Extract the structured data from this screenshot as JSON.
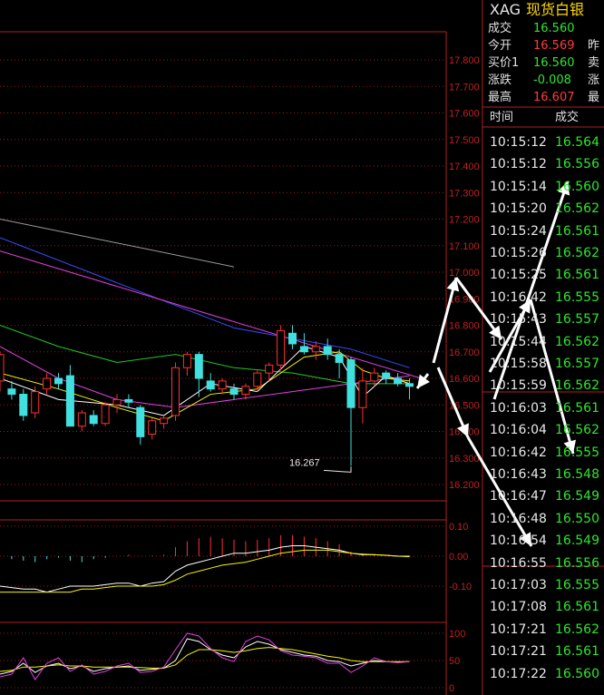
{
  "header": {
    "symbol": "XAG",
    "name": "现货白银"
  },
  "quote": [
    {
      "label": "成交",
      "value": "16.560",
      "color": "#2ee62e",
      "extra": ""
    },
    {
      "label": "今开",
      "value": "16.569",
      "color": "#ff3b3b",
      "extra": "昨"
    },
    {
      "label": "买价1",
      "value": "16.560",
      "color": "#2ee62e",
      "extra": "卖"
    },
    {
      "label": "涨跌",
      "value": "-0.008",
      "color": "#2ee62e",
      "extra": "涨"
    },
    {
      "label": "最高",
      "value": "16.607",
      "color": "#ff3b3b",
      "extra": "最"
    }
  ],
  "ticks_header": {
    "time": "时间",
    "price": "成交"
  },
  "ticks": [
    {
      "time": "10:15:12",
      "price": "16.564"
    },
    {
      "time": "10:15:12",
      "price": "16.556"
    },
    {
      "time": "10:15:14",
      "price": "16.560"
    },
    {
      "time": "10:15:20",
      "price": "16.562"
    },
    {
      "time": "10:15:24",
      "price": "16.561"
    },
    {
      "time": "10:15:26",
      "price": "16.562"
    },
    {
      "time": "10:15:25",
      "price": "16.561"
    },
    {
      "time": "10:16:42",
      "price": "16.555"
    },
    {
      "time": "10:15:43",
      "price": "16.557"
    },
    {
      "time": "10:15:44",
      "price": "16.562"
    },
    {
      "time": "10:15:58",
      "price": "16.557"
    },
    {
      "time": "10:15:59",
      "price": "16.562"
    },
    {
      "time": "10:16:03",
      "price": "16.561"
    },
    {
      "time": "10:16:04",
      "price": "16.562"
    },
    {
      "time": "10:16:42",
      "price": "16.555"
    },
    {
      "time": "10:16:43",
      "price": "16.548"
    },
    {
      "time": "10:16:47",
      "price": "16.549"
    },
    {
      "time": "10:16:48",
      "price": "16.550"
    },
    {
      "time": "10:16:54",
      "price": "16.549"
    },
    {
      "time": "10:16:55",
      "price": "16.556"
    },
    {
      "time": "10:17:03",
      "price": "16.555"
    },
    {
      "time": "10:17:08",
      "price": "16.561"
    },
    {
      "time": "10:17:21",
      "price": "16.562"
    },
    {
      "time": "10:17:21",
      "price": "16.561"
    },
    {
      "time": "10:17:22",
      "price": "16.560"
    }
  ],
  "chart_data": [
    {
      "type": "candlestick",
      "ylim": [
        16.15,
        17.9
      ],
      "yticks": [
        "17.800",
        "17.700",
        "17.600",
        "17.500",
        "17.400",
        "17.300",
        "17.200",
        "17.100",
        "17.000",
        "16.900",
        "16.800",
        "16.700",
        "16.600",
        "16.500",
        "16.400",
        "16.300",
        "16.200"
      ],
      "annotation": "16.267",
      "candles": [
        {
          "o": 16.59,
          "h": 16.7,
          "l": 16.55,
          "c": 16.69
        },
        {
          "o": 16.56,
          "h": 16.59,
          "l": 16.52,
          "c": 16.54
        },
        {
          "o": 16.54,
          "h": 16.56,
          "l": 16.44,
          "c": 16.46
        },
        {
          "o": 16.47,
          "h": 16.57,
          "l": 16.45,
          "c": 16.55
        },
        {
          "o": 16.56,
          "h": 16.62,
          "l": 16.54,
          "c": 16.6
        },
        {
          "o": 16.6,
          "h": 16.62,
          "l": 16.56,
          "c": 16.58
        },
        {
          "o": 16.61,
          "h": 16.65,
          "l": 16.42,
          "c": 16.42
        },
        {
          "o": 16.42,
          "h": 16.48,
          "l": 16.4,
          "c": 16.47
        },
        {
          "o": 16.46,
          "h": 16.48,
          "l": 16.42,
          "c": 16.43
        },
        {
          "o": 16.43,
          "h": 16.51,
          "l": 16.42,
          "c": 16.5
        },
        {
          "o": 16.5,
          "h": 16.54,
          "l": 16.47,
          "c": 16.52
        },
        {
          "o": 16.52,
          "h": 16.54,
          "l": 16.49,
          "c": 16.51
        },
        {
          "o": 16.49,
          "h": 16.5,
          "l": 16.35,
          "c": 16.38
        },
        {
          "o": 16.39,
          "h": 16.45,
          "l": 16.37,
          "c": 16.44
        },
        {
          "o": 16.43,
          "h": 16.46,
          "l": 16.41,
          "c": 16.45
        },
        {
          "o": 16.46,
          "h": 16.66,
          "l": 16.44,
          "c": 16.64
        },
        {
          "o": 16.64,
          "h": 16.7,
          "l": 16.61,
          "c": 16.69
        },
        {
          "o": 16.69,
          "h": 16.7,
          "l": 16.53,
          "c": 16.6
        },
        {
          "o": 16.59,
          "h": 16.62,
          "l": 16.55,
          "c": 16.56
        },
        {
          "o": 16.56,
          "h": 16.6,
          "l": 16.54,
          "c": 16.59
        },
        {
          "o": 16.56,
          "h": 16.58,
          "l": 16.52,
          "c": 16.54
        },
        {
          "o": 16.54,
          "h": 16.58,
          "l": 16.52,
          "c": 16.57
        },
        {
          "o": 16.57,
          "h": 16.63,
          "l": 16.55,
          "c": 16.62
        },
        {
          "o": 16.62,
          "h": 16.66,
          "l": 16.59,
          "c": 16.65
        },
        {
          "o": 16.65,
          "h": 16.8,
          "l": 16.63,
          "c": 16.78
        },
        {
          "o": 16.77,
          "h": 16.8,
          "l": 16.71,
          "c": 16.73
        },
        {
          "o": 16.72,
          "h": 16.77,
          "l": 16.69,
          "c": 16.7
        },
        {
          "o": 16.7,
          "h": 16.74,
          "l": 16.67,
          "c": 16.72
        },
        {
          "o": 16.72,
          "h": 16.75,
          "l": 16.67,
          "c": 16.69
        },
        {
          "o": 16.69,
          "h": 16.71,
          "l": 16.6,
          "c": 16.66
        },
        {
          "o": 16.67,
          "h": 16.68,
          "l": 16.27,
          "c": 16.49
        },
        {
          "o": 16.49,
          "h": 16.64,
          "l": 16.43,
          "c": 16.59
        },
        {
          "o": 16.59,
          "h": 16.64,
          "l": 16.57,
          "c": 16.62
        },
        {
          "o": 16.62,
          "h": 16.63,
          "l": 16.58,
          "c": 16.6
        },
        {
          "o": 16.6,
          "h": 16.62,
          "l": 16.57,
          "c": 16.58
        },
        {
          "o": 16.58,
          "h": 16.6,
          "l": 16.52,
          "c": 16.57
        }
      ],
      "lines": [
        {
          "name": "grey",
          "color": "#9a9a9a",
          "points": [
            [
              0,
              17.2
            ],
            [
              20,
              17.02
            ]
          ]
        },
        {
          "name": "blue",
          "color": "#3b4cff",
          "points": [
            [
              0,
              17.13
            ],
            [
              10,
              16.96
            ],
            [
              20,
              16.79
            ],
            [
              30,
              16.71
            ],
            [
              35,
              16.64
            ]
          ]
        },
        {
          "name": "magenta-trend",
          "color": "#e040e0",
          "points": [
            [
              0,
              17.08
            ],
            [
              36,
              16.6
            ]
          ]
        },
        {
          "name": "green",
          "color": "#22c622",
          "points": [
            [
              0,
              16.8
            ],
            [
              5,
              16.72
            ],
            [
              10,
              16.66
            ],
            [
              15,
              16.69
            ],
            [
              20,
              16.64
            ],
            [
              25,
              16.62
            ],
            [
              30,
              16.58
            ],
            [
              35,
              16.58
            ]
          ]
        },
        {
          "name": "magenta",
          "color": "#e040e0",
          "points": [
            [
              0,
              16.72
            ],
            [
              5,
              16.6
            ],
            [
              10,
              16.52
            ],
            [
              15,
              16.49
            ],
            [
              20,
              16.52
            ],
            [
              25,
              16.55
            ],
            [
              30,
              16.58
            ],
            [
              35,
              16.61
            ]
          ]
        },
        {
          "name": "yellow",
          "color": "#f5f500",
          "points": [
            [
              0,
              16.62
            ],
            [
              5,
              16.56
            ],
            [
              10,
              16.49
            ],
            [
              14,
              16.44
            ],
            [
              18,
              16.54
            ],
            [
              22,
              16.56
            ],
            [
              26,
              16.68
            ],
            [
              29,
              16.7
            ],
            [
              31,
              16.63
            ],
            [
              33,
              16.6
            ],
            [
              35,
              16.59
            ]
          ]
        },
        {
          "name": "white",
          "color": "#ffffff",
          "points": [
            [
              0,
              16.6
            ],
            [
              5,
              16.52
            ],
            [
              10,
              16.5
            ],
            [
              14,
              16.46
            ],
            [
              18,
              16.58
            ],
            [
              22,
              16.55
            ],
            [
              26,
              16.72
            ],
            [
              29,
              16.68
            ],
            [
              31,
              16.53
            ],
            [
              33,
              16.61
            ],
            [
              35,
              16.58
            ]
          ]
        }
      ]
    },
    {
      "type": "macd",
      "ylim": [
        -0.16,
        0.12
      ],
      "yticks": [
        "0.10",
        "0.00",
        "-0.10"
      ],
      "bars": [
        0.0,
        -0.01,
        -0.015,
        -0.02,
        -0.01,
        -0.005,
        -0.015,
        -0.02,
        -0.01,
        -0.005,
        0,
        0.005,
        0,
        0.002,
        0.005,
        0.03,
        0.05,
        0.06,
        0.065,
        0.06,
        0.055,
        0.05,
        0.055,
        0.06,
        0.07,
        0.07,
        0.065,
        0.06,
        0.05,
        0.04,
        0.015,
        0.01,
        0.008,
        0.005,
        0.003,
        0.002
      ],
      "dif": [
        -0.1,
        -0.105,
        -0.11,
        -0.11,
        -0.12,
        -0.11,
        -0.1,
        -0.1,
        -0.1,
        -0.095,
        -0.09,
        -0.09,
        -0.1,
        -0.09,
        -0.085,
        -0.05,
        -0.03,
        -0.02,
        -0.01,
        0.0,
        0.01,
        0.01,
        0.015,
        0.02,
        0.03,
        0.035,
        0.035,
        0.03,
        0.025,
        0.02,
        0.01,
        0.005,
        0.005,
        0.003,
        0.0,
        0.0
      ],
      "dea": [
        -0.12,
        -0.12,
        -0.12,
        -0.12,
        -0.12,
        -0.12,
        -0.12,
        -0.11,
        -0.11,
        -0.105,
        -0.1,
        -0.1,
        -0.1,
        -0.1,
        -0.095,
        -0.08,
        -0.06,
        -0.05,
        -0.04,
        -0.03,
        -0.025,
        -0.02,
        -0.01,
        0.0,
        0.01,
        0.015,
        0.02,
        0.02,
        0.02,
        0.015,
        0.01,
        0.007,
        0.005,
        0.003,
        0.0,
        -0.002
      ]
    },
    {
      "type": "kdj",
      "ylim": [
        0,
        110
      ],
      "yticks": [
        "100",
        "50",
        "0"
      ],
      "k": [
        25,
        30,
        45,
        28,
        40,
        45,
        35,
        40,
        30,
        35,
        38,
        40,
        32,
        34,
        36,
        50,
        90,
        85,
        70,
        60,
        55,
        75,
        85,
        80,
        70,
        65,
        60,
        58,
        50,
        48,
        40,
        45,
        50,
        48,
        47,
        48
      ],
      "d": [
        30,
        32,
        38,
        38,
        40,
        42,
        40,
        40,
        38,
        38,
        38,
        38,
        37,
        36,
        36,
        42,
        60,
        70,
        70,
        68,
        65,
        68,
        72,
        74,
        72,
        70,
        66,
        62,
        58,
        55,
        50,
        48,
        48,
        48,
        48,
        48
      ],
      "j": [
        20,
        25,
        55,
        15,
        45,
        55,
        30,
        42,
        25,
        30,
        40,
        45,
        28,
        30,
        38,
        70,
        100,
        95,
        72,
        55,
        48,
        85,
        95,
        88,
        68,
        60,
        58,
        55,
        45,
        45,
        28,
        40,
        55,
        48,
        46,
        48
      ]
    }
  ]
}
